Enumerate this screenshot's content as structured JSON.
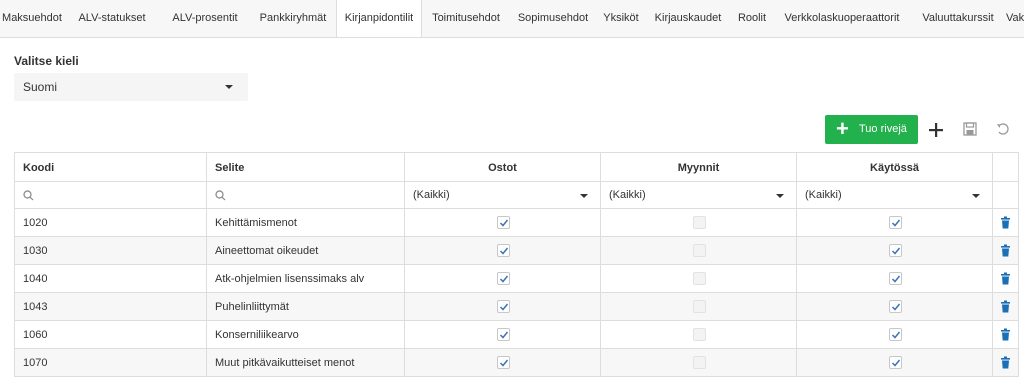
{
  "tabs": [
    {
      "label": "Maksuehdot"
    },
    {
      "label": "ALV-statukset"
    },
    {
      "label": "ALV-prosentit"
    },
    {
      "label": "Pankkiryhmät"
    },
    {
      "label": "Kirjanpidontilit",
      "active": true
    },
    {
      "label": "Toimitusehdot"
    },
    {
      "label": "Sopimusehdot"
    },
    {
      "label": "Yksiköt"
    },
    {
      "label": "Kirjauskaudet"
    },
    {
      "label": "Roolit"
    },
    {
      "label": "Verkkolaskuoperaattorit"
    },
    {
      "label": "Valuuttakurssit"
    },
    {
      "label": "Vak"
    }
  ],
  "language": {
    "label": "Valitse kieli",
    "selected": "Suomi"
  },
  "toolbar": {
    "add_rows_label": "Tuo rivejä",
    "colors": {
      "primary": "#22b14c",
      "icon": "#333333",
      "disabled": "#999999"
    }
  },
  "table": {
    "columns": [
      "Koodi",
      "Selite",
      "Ostot",
      "Myynnit",
      "Käytössä"
    ],
    "filters": {
      "ostot": "(Kaikki)",
      "myynnit": "(Kaikki)",
      "kaytossa": "(Kaikki)"
    },
    "rows": [
      {
        "koodi": "1020",
        "selite": "Kehittämismenot",
        "ostot": true,
        "myynnit": false,
        "kaytossa": true
      },
      {
        "koodi": "1030",
        "selite": "Aineettomat oikeudet",
        "ostot": true,
        "myynnit": false,
        "kaytossa": true
      },
      {
        "koodi": "1040",
        "selite": "Atk-ohjelmien lisenssimaks alv",
        "ostot": true,
        "myynnit": false,
        "kaytossa": true
      },
      {
        "koodi": "1043",
        "selite": "Puhelinliittymät",
        "ostot": true,
        "myynnit": false,
        "kaytossa": true
      },
      {
        "koodi": "1060",
        "selite": "Konserniliikearvo",
        "ostot": true,
        "myynnit": false,
        "kaytossa": true
      },
      {
        "koodi": "1070",
        "selite": "Muut pitkävaikutteiset menot",
        "ostot": true,
        "myynnit": false,
        "kaytossa": true
      }
    ],
    "delete_icon_color": "#1a6fb5"
  }
}
